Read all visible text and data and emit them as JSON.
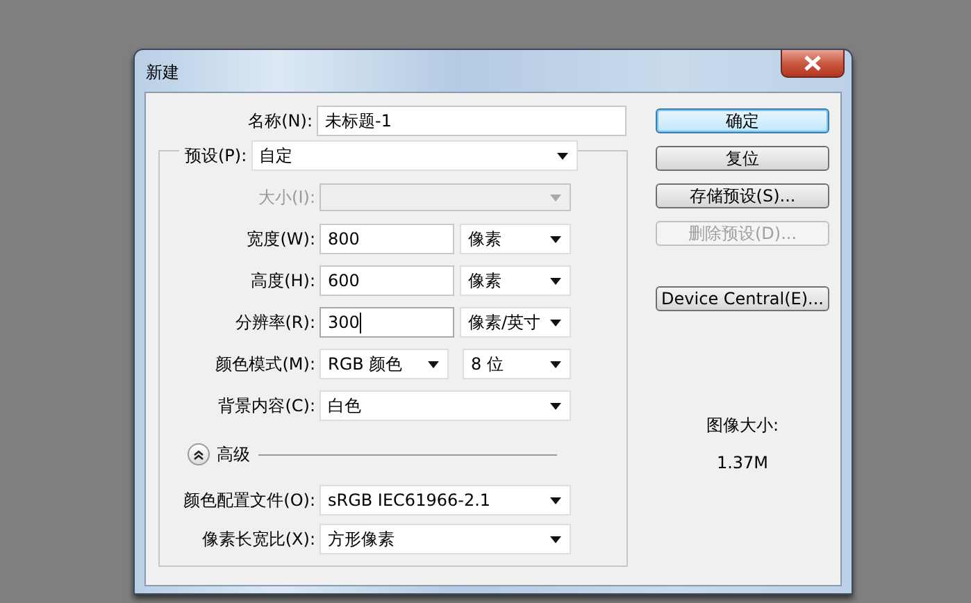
{
  "window": {
    "title": "新建"
  },
  "name_field": {
    "label": "名称(N):",
    "value": "未标题-1"
  },
  "preset": {
    "label": "预设(P):",
    "value": "自定"
  },
  "rows": [
    {
      "kind": "select",
      "label": "大小(I):",
      "disabled": true
    },
    {
      "kind": "input_unit",
      "label": "宽度(W):",
      "value": "800",
      "unit": "像素",
      "focused": false
    },
    {
      "kind": "input_unit",
      "label": "高度(H):",
      "value": "600",
      "unit": "像素",
      "focused": false
    },
    {
      "kind": "input_unit",
      "label": "分辨率(R):",
      "value": "300",
      "unit": "像素/英寸",
      "focused": true
    },
    {
      "kind": "select_pair",
      "label": "颜色模式(M):",
      "value": "RGB 颜色",
      "unit": "8 位"
    },
    {
      "kind": "select",
      "label": "背景内容(C):",
      "value": "白色",
      "disabled": false
    }
  ],
  "advanced": {
    "label": "高级",
    "expanded": true
  },
  "advanced_rows": [
    {
      "kind": "select",
      "label": "颜色配置文件(O):",
      "value": "sRGB IEC61966-2.1",
      "disabled": false
    },
    {
      "kind": "select",
      "label": "像素长宽比(X):",
      "value": "方形像素",
      "disabled": false
    }
  ],
  "buttons": [
    {
      "label": "确定",
      "default": true,
      "disabled": false
    },
    {
      "label": "复位",
      "default": false,
      "disabled": false
    },
    {
      "label": "存储预设(S)...",
      "default": false,
      "disabled": false
    },
    {
      "label": "删除预设(D)...",
      "default": false,
      "disabled": true
    },
    {
      "label": "Device Central(E)...",
      "default": false,
      "disabled": false
    }
  ],
  "image_size": {
    "label": "图像大小:",
    "value": "1.37M"
  }
}
